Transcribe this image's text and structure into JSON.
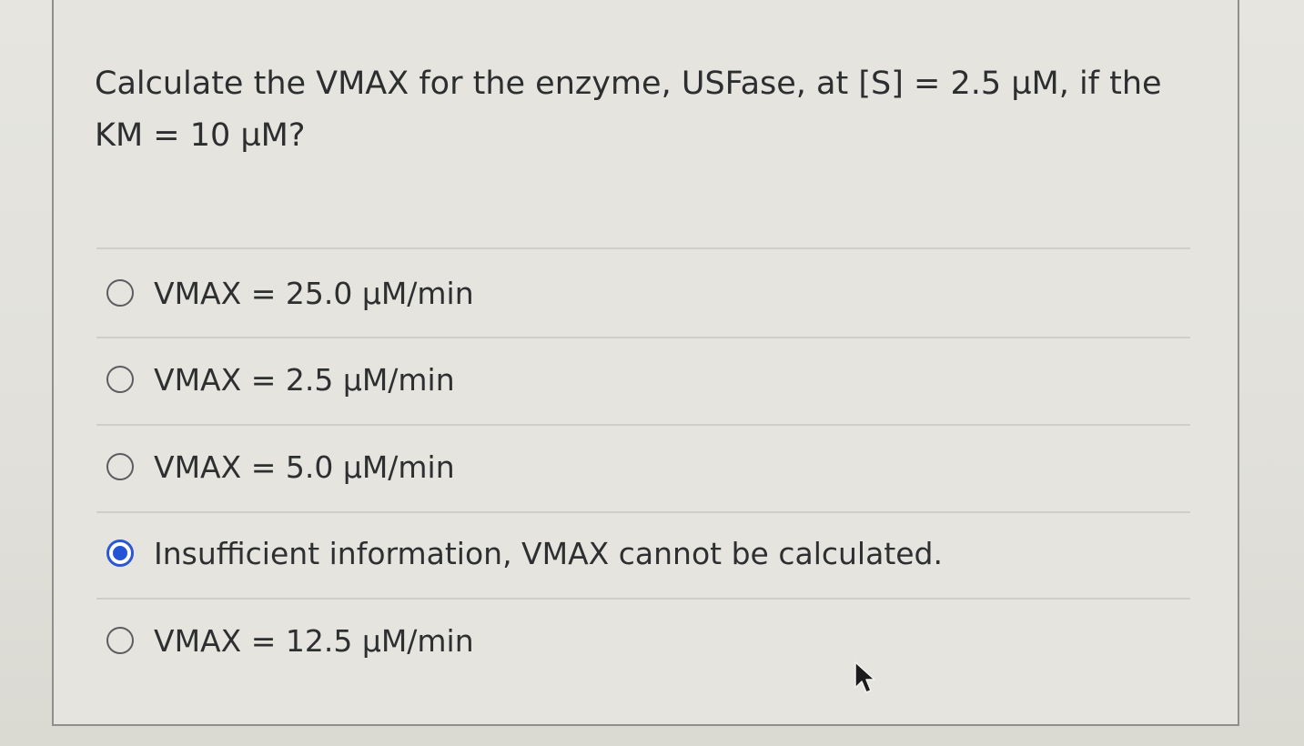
{
  "question": {
    "line1": "Calculate the VMAX for the enzyme, USFase, at [S] = 2.5 µM, if the",
    "line2": "KM = 10 µM?"
  },
  "answers": [
    {
      "label": "VMAX = 25.0 µM/min",
      "selected": false
    },
    {
      "label": "VMAX = 2.5 µM/min",
      "selected": false
    },
    {
      "label": "VMAX = 5.0 µM/min",
      "selected": false
    },
    {
      "label": "Insufficient information, VMAX cannot be calculated.",
      "selected": true
    },
    {
      "label": "VMAX = 12.5 µM/min",
      "selected": false
    }
  ],
  "colors": {
    "accent": "#2454d6",
    "text": "#2e2f31",
    "background": "#e5e4df"
  },
  "icons": {
    "cursor": "mouse-pointer-icon",
    "radio": "radio-button-icon"
  }
}
